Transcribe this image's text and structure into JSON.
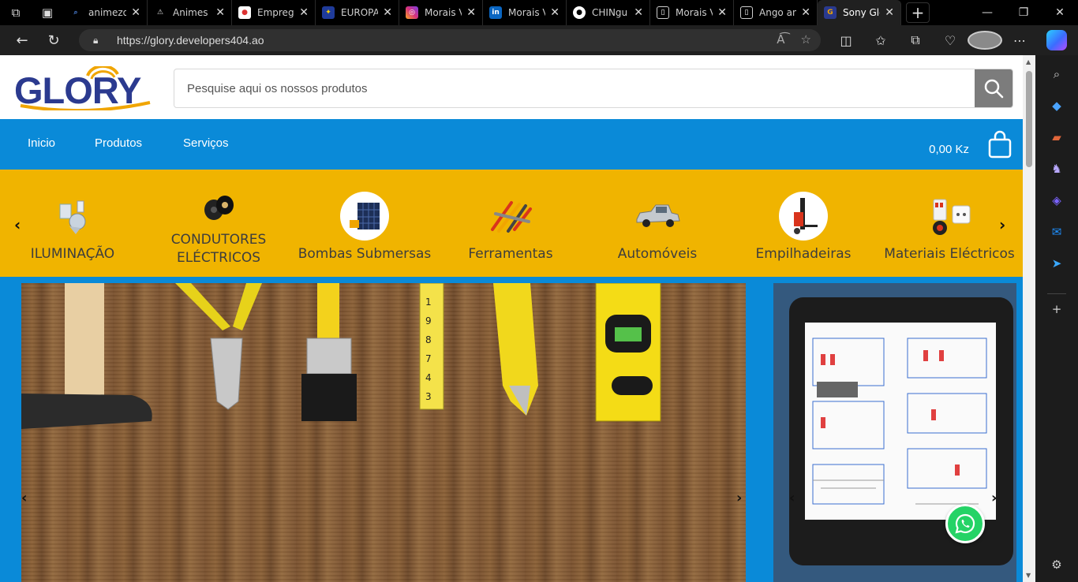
{
  "browser": {
    "tabs": [
      {
        "title": "animezone",
        "favicon": "search-icon",
        "fav_color": "#2b2b2b"
      },
      {
        "title": "Animes",
        "favicon": "triangle-icon",
        "fav_color": "#2b2b2b"
      },
      {
        "title": "Empregos",
        "favicon": "jobs-icon",
        "fav_color": "#ffffff"
      },
      {
        "title": "EUROPA",
        "favicon": "eu-flag-icon",
        "fav_color": "#1f3b9a"
      },
      {
        "title": "Morais Vicente",
        "favicon": "instagram-icon",
        "fav_color": "#d6307d"
      },
      {
        "title": "Morais Vicente",
        "favicon": "linkedin-icon",
        "fav_color": "#0a66c2"
      },
      {
        "title": "CHINgu",
        "favicon": "github-icon",
        "fav_color": "#ffffff"
      },
      {
        "title": "Morais Vicente",
        "favicon": "document-icon",
        "fav_color": "#2b2b2b"
      },
      {
        "title": "Ango ano",
        "favicon": "document-icon",
        "fav_color": "#2b2b2b"
      },
      {
        "title": "Sony Glory",
        "favicon": "glory-icon",
        "fav_color": "#2a3a8f",
        "active": true
      }
    ],
    "url": "https://glory.developers404.ao"
  },
  "site": {
    "logo_text": "GLORY",
    "brand_blue": "#2b3a8f",
    "brand_orange": "#f0a500",
    "search_placeholder": "Pesquise aqui os nossos produtos",
    "nav": [
      "Inicio",
      "Produtos",
      "Serviços"
    ],
    "cart_total": "0,00 Kz",
    "nav_color": "#0a8ad8",
    "category_bg": "#f0b400"
  },
  "categories": [
    {
      "label": "ILUMINAÇÃO",
      "icon": "lighting-icon"
    },
    {
      "label": "CONDUTORES ELÉCTRICOS",
      "icon": "cable-reel-icon"
    },
    {
      "label": "Bombas Submersas",
      "icon": "solar-pump-icon"
    },
    {
      "label": "Ferramentas",
      "icon": "tools-icon"
    },
    {
      "label": "Automóveis",
      "icon": "pickup-truck-icon"
    },
    {
      "label": "Empilhadeiras",
      "icon": "forklift-icon"
    },
    {
      "label": "Materiais Eléctricos",
      "icon": "electrical-materials-icon"
    }
  ],
  "banners": [
    {
      "name": "tools-on-wood-banner"
    },
    {
      "name": "electrical-panel-tablet-banner"
    }
  ]
}
